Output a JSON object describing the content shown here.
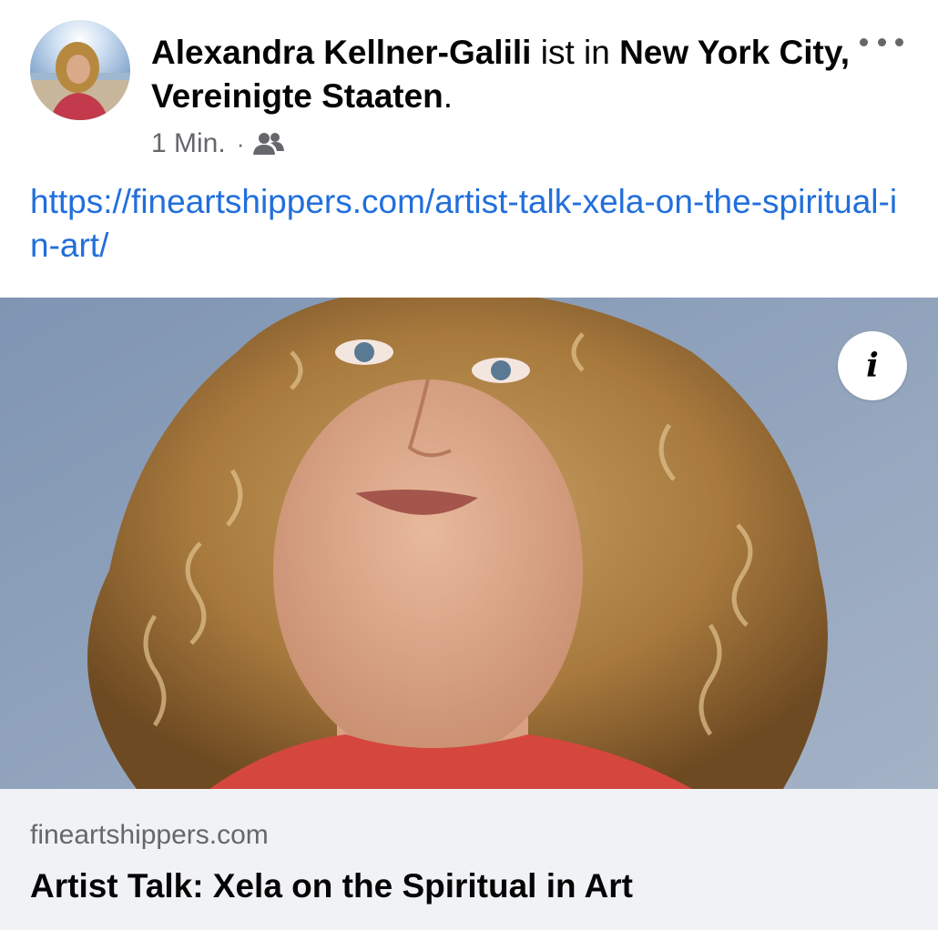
{
  "post": {
    "author_name": "Alexandra Kellner-Galili",
    "checkin_connector": "ist in",
    "location": "New York City, Vereinigte Staaten",
    "location_end": ".",
    "timestamp": "1 Min.",
    "separator": "·",
    "audience_icon": "friends-icon",
    "more_icon": "more-options-icon",
    "text_link": "https://fineartshippers.com/artist-talk-xela-on-the-spiritual-in-art/"
  },
  "link_preview": {
    "domain": "fineartshippers.com",
    "title": "Artist Talk: Xela on the Spiritual in Art",
    "info_label": "i"
  },
  "colors": {
    "link_blue": "#216fdb",
    "secondary_text": "#65676b",
    "card_footer_bg": "#f0f2f5"
  }
}
